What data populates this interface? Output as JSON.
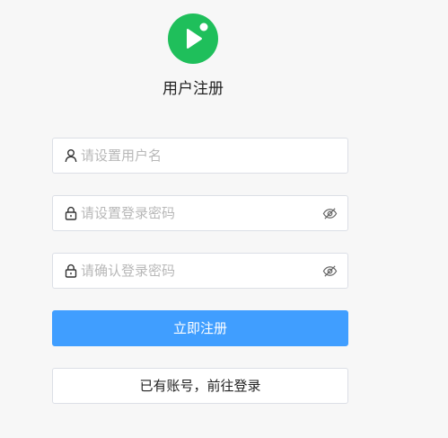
{
  "logo": {
    "icon": "play-logo-icon",
    "color": "#1fbf5b"
  },
  "title": "用户注册",
  "fields": {
    "username": {
      "placeholder": "请设置用户名",
      "value": "",
      "icon": "user-icon"
    },
    "password": {
      "placeholder": "请设置登录密码",
      "value": "",
      "icon": "lock-icon",
      "toggle_icon": "eye-hidden-icon"
    },
    "confirm_password": {
      "placeholder": "请确认登录密码",
      "value": "",
      "icon": "lock-icon",
      "toggle_icon": "eye-hidden-icon"
    }
  },
  "buttons": {
    "register": "立即注册",
    "login": "已有账号，前往登录"
  },
  "colors": {
    "primary": "#409eff",
    "background": "#f7f7f7"
  }
}
